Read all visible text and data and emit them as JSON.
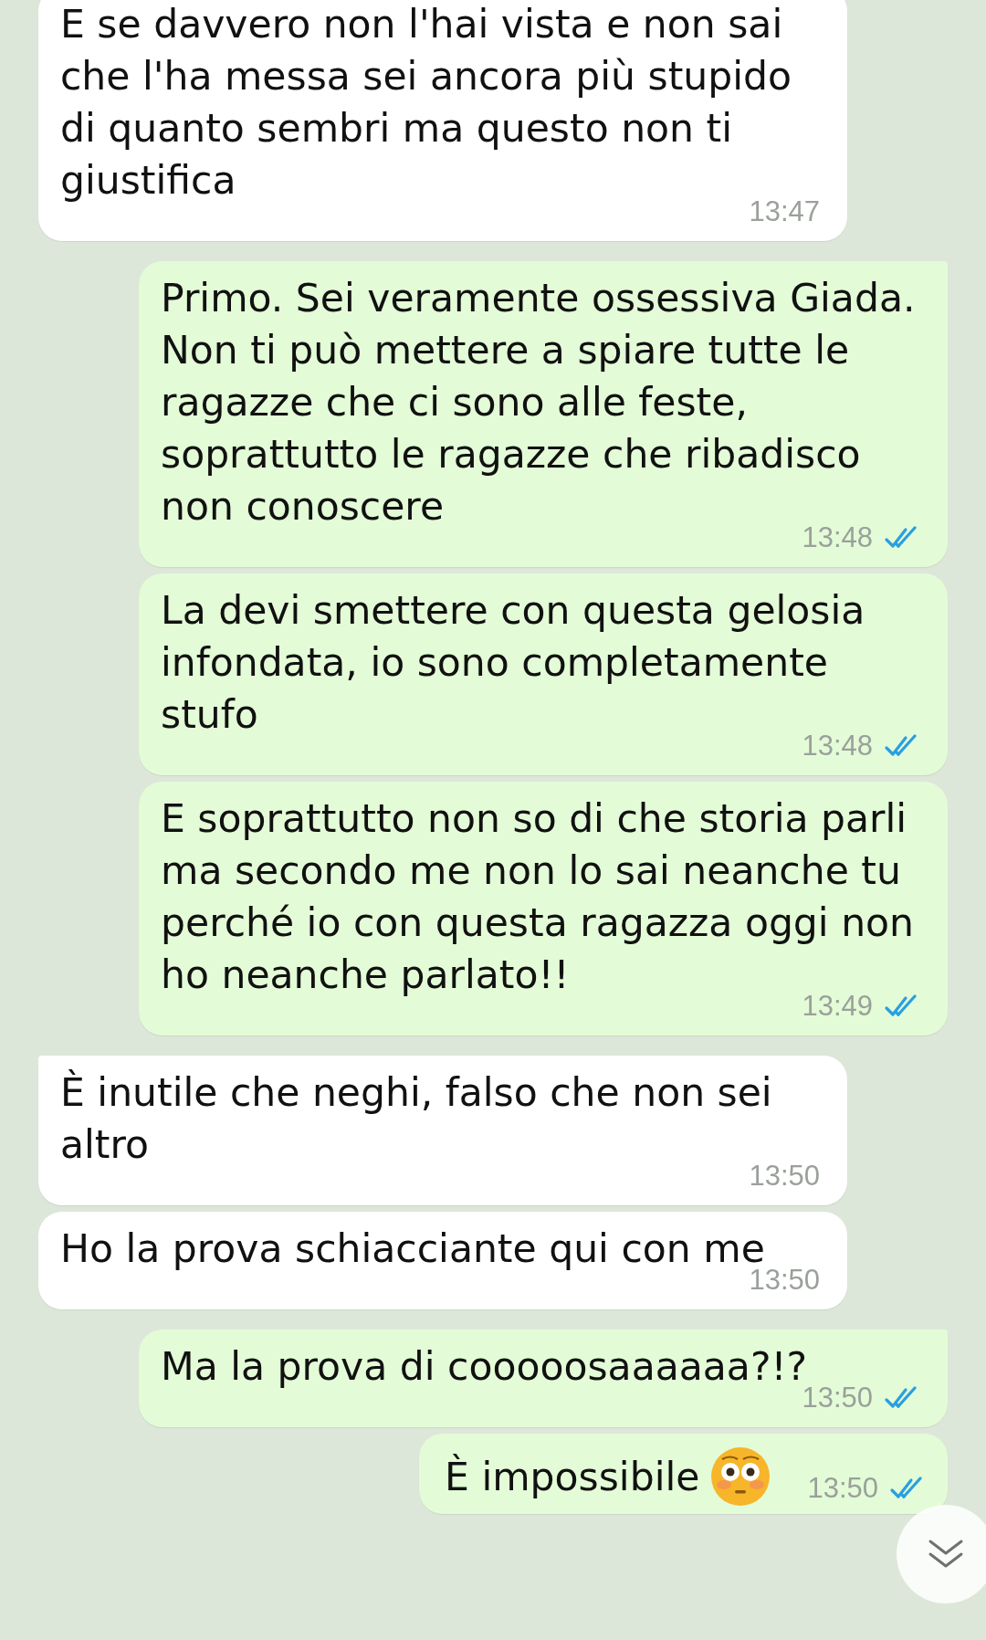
{
  "messages": [
    {
      "kind": "incoming",
      "text": "E se davvero non l'hai vista e non sai che l'ha messa sei ancora più stupido di quanto sembri ma questo non ti giustifica",
      "time": "13:47"
    },
    {
      "kind": "outgoing",
      "text": "Primo. Sei veramente ossessiva Giada. Non ti può mettere a spiare tutte le ragazze che ci sono alle feste, soprattutto le ragazze che ribadisco non conoscere",
      "time": "13:48",
      "read": true
    },
    {
      "kind": "outgoing",
      "text": "La devi smettere con questa gelosia infondata, io sono completamente stufo",
      "time": "13:48",
      "read": true
    },
    {
      "kind": "outgoing",
      "text": "E soprattutto non so di che storia parli ma secondo me non lo sai neanche tu perché io con questa ragazza oggi non ho neanche parlato!!",
      "time": "13:49",
      "read": true
    },
    {
      "kind": "incoming",
      "text": "È inutile che neghi, falso che non sei altro",
      "time": "13:50"
    },
    {
      "kind": "incoming",
      "text": "Ho la prova schiacciante qui con me",
      "time": "13:50"
    },
    {
      "kind": "outgoing",
      "text": "Ma la prova di cooooosaaaaaa?!?",
      "time": "13:50",
      "read": true
    },
    {
      "kind": "outgoing",
      "text": "È impossibile",
      "emoji": true,
      "time": "13:50",
      "read": true,
      "inline_time": true
    }
  ]
}
